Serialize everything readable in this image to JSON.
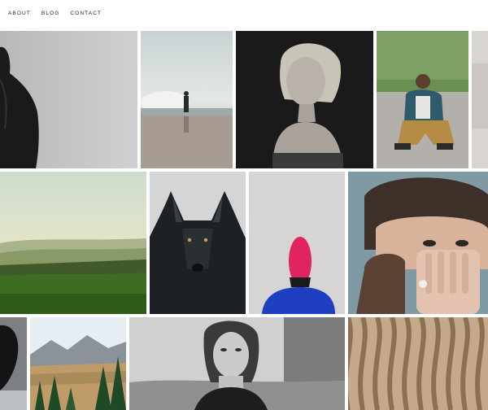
{
  "nav": {
    "items": [
      {
        "label": "ABOUT"
      },
      {
        "label": "BLOG"
      },
      {
        "label": "CONTACT"
      }
    ]
  },
  "gallery": {
    "rows": [
      {
        "photos": [
          {
            "subject": "man-back-portrait"
          },
          {
            "subject": "person-at-sea-wave"
          },
          {
            "subject": "blonde-woman-portrait"
          },
          {
            "subject": "man-sitting-on-road"
          },
          {
            "subject": "partial-photo"
          }
        ]
      },
      {
        "photos": [
          {
            "subject": "green-hills-landscape"
          },
          {
            "subject": "black-wolf"
          },
          {
            "subject": "red-masked-figure"
          },
          {
            "subject": "woman-fur-hat"
          }
        ]
      },
      {
        "photos": [
          {
            "subject": "dark-profile"
          },
          {
            "subject": "mountain-forest"
          },
          {
            "subject": "woman-wet-hair"
          },
          {
            "subject": "wavy-wood-texture"
          }
        ]
      }
    ]
  },
  "colors": {
    "background": "#ffffff",
    "nav_text": "#222222"
  }
}
